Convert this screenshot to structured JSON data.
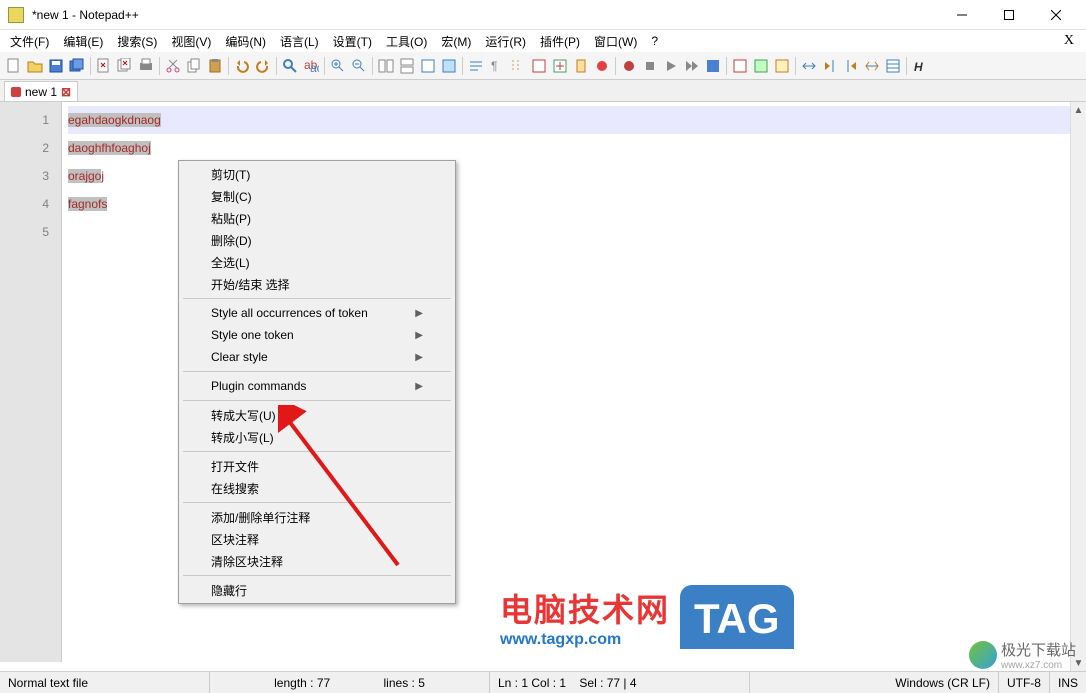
{
  "window": {
    "title": "*new 1 - Notepad++"
  },
  "menubar": {
    "items": [
      "文件(F)",
      "编辑(E)",
      "搜索(S)",
      "视图(V)",
      "编码(N)",
      "语言(L)",
      "设置(T)",
      "工具(O)",
      "宏(M)",
      "运行(R)",
      "插件(P)",
      "窗口(W)",
      "?"
    ],
    "x_close": "X"
  },
  "tabs": {
    "tab1": {
      "label": "new 1"
    }
  },
  "editor": {
    "line_numbers": [
      "1",
      "2",
      "3",
      "4",
      "5"
    ],
    "lines": [
      {
        "text": "egahdaogkdnaog",
        "selected": true,
        "highlighted": true
      },
      {
        "text": "daoghfhfoaghoj",
        "selected": true
      },
      {
        "text": "orajgoj",
        "selected_part": "orajgo",
        "rest": "j"
      },
      {
        "text": "fagnofs",
        "selected_part": "fagnofs",
        "rest": ""
      },
      {
        "text": ""
      }
    ]
  },
  "context_menu": {
    "group1": [
      "剪切(T)",
      "复制(C)",
      "粘贴(P)",
      "删除(D)",
      "全选(L)",
      "开始/结束 选择"
    ],
    "group2": [
      {
        "label": "Style all occurrences of token",
        "submenu": true
      },
      {
        "label": "Style one token",
        "submenu": true
      },
      {
        "label": "Clear style",
        "submenu": true
      }
    ],
    "group3": [
      {
        "label": "Plugin commands",
        "submenu": true
      }
    ],
    "group4": [
      "转成大写(U)",
      "转成小写(L)"
    ],
    "group5": [
      "打开文件",
      "在线搜索"
    ],
    "group6": [
      "添加/删除单行注释",
      "区块注释",
      "清除区块注释"
    ],
    "group7": [
      "隐藏行"
    ]
  },
  "statusbar": {
    "file_type": "Normal text file",
    "length_label": "length : 77",
    "lines_label": "lines : 5",
    "pos": "Ln : 1    Col : 1",
    "sel": "Sel : 77 | 4",
    "eol": "Windows (CR LF)",
    "encoding": "UTF-8",
    "mode": "INS"
  },
  "watermark": {
    "cn_text": "电脑技术网",
    "url": "www.tagxp.com",
    "tag": "TAG",
    "wm2_text": "极光下载站",
    "wm2_url": "www.xz7.com"
  }
}
